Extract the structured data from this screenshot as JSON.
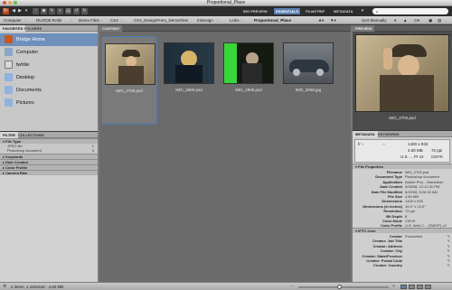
{
  "window": {
    "title": "Proportional_Place"
  },
  "toolbar": {
    "workspaces": [
      {
        "label": "BIG PREVIEW",
        "active": false
      },
      {
        "label": "ESSENTIALS",
        "active": true
      },
      {
        "label": "FILMSTRIP",
        "active": false
      },
      {
        "label": "METADATA",
        "active": false
      }
    ],
    "search_placeholder": "ρ"
  },
  "path": {
    "crumbs": [
      "Computer",
      "DUOCB RAID",
      "Demo Files",
      "CS4",
      "CS4_DesignPrem_DemoFiles",
      "InDesign",
      "Links",
      "Proportional_Place"
    ],
    "sort_label": "Sort Manually"
  },
  "left_panel": {
    "tabs": [
      "FAVORITES",
      "FOLDERS"
    ],
    "favorites": [
      {
        "label": "Bridge Home",
        "icon": "bridge-home-icon",
        "color": "#c65a1e"
      },
      {
        "label": "Computer",
        "icon": "computer-icon",
        "color": "#8aa6c8"
      },
      {
        "label": "twhite",
        "icon": "home-icon",
        "color": "#d9d9d9"
      },
      {
        "label": "Desktop",
        "icon": "desktop-folder-icon",
        "color": "#8fb3de"
      },
      {
        "label": "Documents",
        "icon": "documents-folder-icon",
        "color": "#8fb3de"
      },
      {
        "label": "Pictures",
        "icon": "pictures-folder-icon",
        "color": "#8fb3de"
      }
    ]
  },
  "filter_panel": {
    "tabs": [
      "FILTER",
      "COLLECTIONS"
    ],
    "sections": [
      {
        "label": "File Type",
        "rows": [
          {
            "label": "JPEG file",
            "count": "1"
          },
          {
            "label": "Photoshop document",
            "count": "3"
          }
        ]
      },
      {
        "label": "Keywords",
        "rows": []
      },
      {
        "label": "Date Created",
        "rows": []
      },
      {
        "label": "Color Profile",
        "rows": []
      },
      {
        "label": "Camera Raw",
        "rows": []
      }
    ]
  },
  "content": {
    "tab": "CONTENT",
    "items": [
      {
        "name": "IMG_2700.psd",
        "selected": true
      },
      {
        "name": "IMG_2800.psd",
        "selected": false
      },
      {
        "name": "IMG_2900.psd",
        "selected": false
      },
      {
        "name": "IMG_3000.jpg",
        "selected": false
      }
    ]
  },
  "preview": {
    "tab": "PREVIEW",
    "name": "IMG_2700.psd"
  },
  "metadata": {
    "tabs": [
      "METADATA",
      "KEYWORDS"
    ],
    "summary": {
      "aperture": "f/ --",
      "shutter": "--",
      "dimensions": "1400 x 933",
      "size": "4.60 MB",
      "resolution": "72 ppi",
      "color_space": "U.S. ... Pr v2",
      "mode": "CMYK"
    },
    "file_properties_label": "File Properties",
    "file_properties": [
      {
        "k": "Filename",
        "v": "IMG_2700.psd"
      },
      {
        "k": "Document Type",
        "v": "Photoshop document"
      },
      {
        "k": "Application",
        "v": "Adobe Pho... Macintosh"
      },
      {
        "k": "Date Created",
        "v": "5/28/08, 12:12:31 PM"
      },
      {
        "k": "Date File Modified",
        "v": "6/20/08, 5:26:32 AM"
      },
      {
        "k": "File Size",
        "v": "4.60 MB"
      },
      {
        "k": "Dimensions",
        "v": "1400 x 933"
      },
      {
        "k": "Dimensions (in inches)",
        "v": "19.4\" x 13.0\""
      },
      {
        "k": "Resolution",
        "v": "72 ppi"
      },
      {
        "k": "Bit Depth",
        "v": "8"
      },
      {
        "k": "Color Mode",
        "v": "CMYK"
      },
      {
        "k": "Color Profile",
        "v": "U.S. Web C... (SWOP) v2"
      }
    ],
    "iptc_label": "IPTC Core",
    "iptc": [
      {
        "k": "Creator",
        "v": "Production"
      },
      {
        "k": "Creator: Job Title",
        "v": ""
      },
      {
        "k": "Creator: Address",
        "v": ""
      },
      {
        "k": "Creator: City",
        "v": ""
      },
      {
        "k": "Creator: State/Province",
        "v": ""
      },
      {
        "k": "Creator: Postal Code",
        "v": ""
      },
      {
        "k": "Creator: Country",
        "v": ""
      }
    ]
  },
  "status": {
    "text": "4 items, 1 selected - 4.60 MB",
    "thumbnail_size": 0.45
  }
}
